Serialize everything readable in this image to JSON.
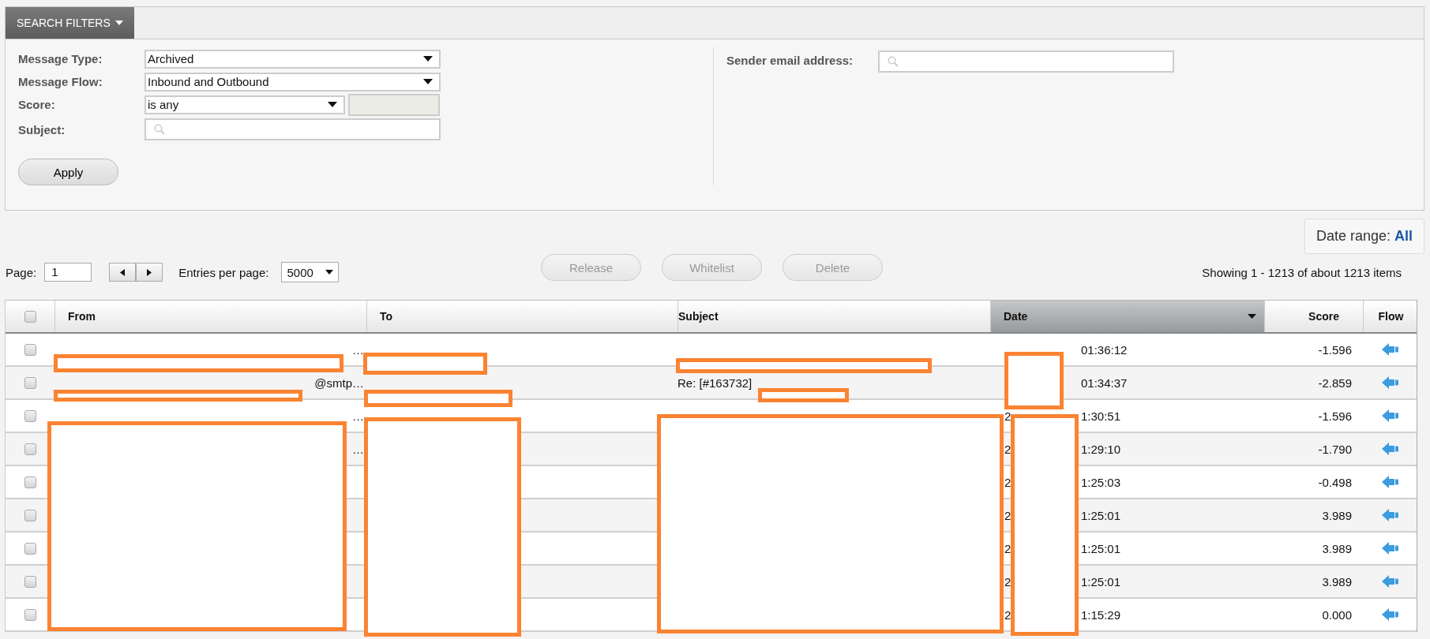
{
  "filter_panel": {
    "tab": "SEARCH FILTERS",
    "fields": [
      {
        "label": "Message Type:",
        "kind": "select",
        "value": "Archived"
      },
      {
        "label": "Message Flow:",
        "kind": "select",
        "value": "Inbound and Outbound"
      },
      {
        "label": "Score:",
        "kind": "score",
        "value": "is any"
      },
      {
        "label": "Subject:",
        "kind": "search"
      }
    ],
    "apply": "Apply",
    "sender": {
      "label": "Sender email address:"
    }
  },
  "date_range": {
    "label": "Date range:",
    "value": "All"
  },
  "pager": {
    "page_label": "Page:",
    "page": "1",
    "entries_label": "Entries per page:",
    "entries": "5000"
  },
  "actions": [
    {
      "label": "Release",
      "disabled": true
    },
    {
      "label": "Whitelist",
      "disabled": true
    },
    {
      "label": "Delete",
      "disabled": true
    }
  ],
  "showing": "Showing 1 - 1213 of about 1213 items",
  "table": {
    "columns": [
      {
        "label": "From",
        "sorted": false
      },
      {
        "label": "To",
        "sorted": false
      },
      {
        "label": "Subject",
        "sorted": false
      },
      {
        "label": "Date",
        "sorted": true
      },
      {
        "label": "Score",
        "sorted": false
      },
      {
        "label": "Flow",
        "sorted": false
      }
    ],
    "header_checked": false,
    "rows": [
      {
        "checked": false,
        "from": "…",
        "date": "01:36:12",
        "score": "-1.596",
        "kind": "inbound"
      },
      {
        "checked": false,
        "from": "@smtp…",
        "subject": "Re: [#163732]",
        "date": "01:34:37",
        "score": "-2.859",
        "kind": "inbound"
      },
      {
        "checked": false,
        "from": "…",
        "date_start": "2",
        "date": "1:30:51",
        "score": "-1.596",
        "kind": "inbound"
      },
      {
        "checked": false,
        "from": "…",
        "date_start": "2",
        "date": "1:29:10",
        "score": "-1.790",
        "kind": "inbound"
      },
      {
        "checked": false,
        "date_start": "2",
        "date": "1:25:03",
        "score": "-0.498",
        "kind": "inbound"
      },
      {
        "checked": false,
        "date_start": "2",
        "date": "1:25:01",
        "score": "3.989",
        "kind": "inbound"
      },
      {
        "checked": false,
        "date_start": "2",
        "date": "1:25:01",
        "score": "3.989",
        "kind": "inbound"
      },
      {
        "checked": false,
        "date_start": "2",
        "date": "1:25:01",
        "score": "3.989",
        "kind": "inbound"
      },
      {
        "checked": false,
        "date_start": "2",
        "date": "1:15:29",
        "score": "0.000",
        "kind": "inbound"
      }
    ]
  }
}
